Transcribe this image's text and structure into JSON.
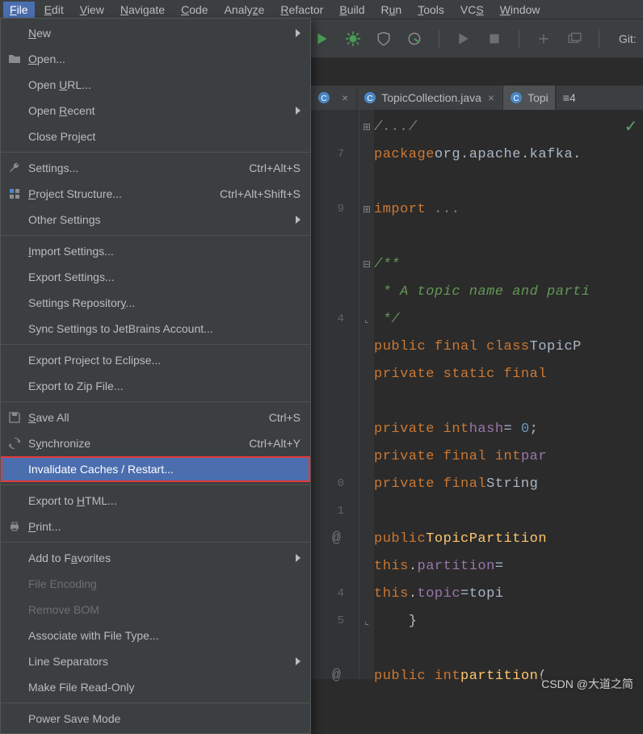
{
  "menubar": {
    "items": [
      {
        "html": "<u>F</u>ile",
        "active": true
      },
      {
        "html": "<u>E</u>dit"
      },
      {
        "html": "<u>V</u>iew"
      },
      {
        "html": "<u>N</u>avigate"
      },
      {
        "html": "<u>C</u>ode"
      },
      {
        "html": "Analy<u>z</u>e"
      },
      {
        "html": "<u>R</u>efactor"
      },
      {
        "html": "<u>B</u>uild"
      },
      {
        "html": "R<u>u</u>n"
      },
      {
        "html": "<u>T</u>ools"
      },
      {
        "html": "VC<u>S</u>"
      },
      {
        "html": "<u>W</u>indow"
      }
    ]
  },
  "file_menu": {
    "groups": [
      [
        {
          "icon": null,
          "label": "<u>N</u>ew",
          "arrow": true
        },
        {
          "icon": "folder",
          "label": "<u>O</u>pen..."
        },
        {
          "icon": null,
          "label": "Open <u>U</u>RL..."
        },
        {
          "icon": null,
          "label": "Open <u>R</u>ecent",
          "arrow": true
        },
        {
          "icon": null,
          "label": "Close Pro<u>j</u>ect"
        }
      ],
      [
        {
          "icon": "wrench",
          "label": "Settings...",
          "shortcut": "Ctrl+Alt+S"
        },
        {
          "icon": "project",
          "label": "<u>P</u>roject Structure...",
          "shortcut": "Ctrl+Alt+Shift+S"
        },
        {
          "icon": null,
          "label": "Other Settings",
          "arrow": true
        }
      ],
      [
        {
          "icon": null,
          "label": "<u>I</u>mport Settings..."
        },
        {
          "icon": null,
          "label": "Export Settings..."
        },
        {
          "icon": null,
          "label": "Settings Repositor<u>y</u>..."
        },
        {
          "icon": null,
          "label": "Sync Settings to JetBrains Account..."
        }
      ],
      [
        {
          "icon": null,
          "label": "Export Project to Eclipse..."
        },
        {
          "icon": null,
          "label": "Export to Zip File..."
        }
      ],
      [
        {
          "icon": "save",
          "label": "<u>S</u>ave All",
          "shortcut": "Ctrl+S"
        },
        {
          "icon": "sync",
          "label": "S<u>y</u>nchronize",
          "shortcut": "Ctrl+Alt+Y"
        },
        {
          "icon": null,
          "label": "Invalidate Caches / Restart...",
          "highlighted": true
        }
      ],
      [
        {
          "icon": null,
          "label": "Export to <u>H</u>TML..."
        },
        {
          "icon": "print",
          "label": "<u>P</u>rint..."
        }
      ],
      [
        {
          "icon": null,
          "label": "Add to F<u>a</u>vorites",
          "arrow": true
        },
        {
          "icon": null,
          "label": "File Encoding",
          "disabled": true
        },
        {
          "icon": null,
          "label": "Remove BOM",
          "disabled": true
        },
        {
          "icon": null,
          "label": "Associate with File Type..."
        },
        {
          "icon": null,
          "label": "Line Separators",
          "arrow": true
        },
        {
          "icon": null,
          "label": "Make File Read-Only"
        }
      ],
      [
        {
          "icon": null,
          "label": "Power Save Mode"
        }
      ]
    ]
  },
  "toolbar": {
    "git_label": "Git:"
  },
  "tabs": {
    "items": [
      {
        "label": "",
        "trunc": true,
        "close": true
      },
      {
        "label": "TopicCollection.java",
        "close": true
      },
      {
        "label": "Topi",
        "active": true
      }
    ],
    "overflow": "≡4"
  },
  "editor": {
    "lines": [
      {
        "ln": "",
        "html": "<span class='cmt'>/.../</span>",
        "fold": "box"
      },
      {
        "ln": "7",
        "html": "<span class='kw'>package</span> <span class='pkg'>org.apache.kafka</span>."
      },
      {
        "ln": "",
        "html": ""
      },
      {
        "ln": "9",
        "html": "<span class='kw'>import</span><span class='cmt'> ...</span>",
        "fold": "plus"
      },
      {
        "ln": "",
        "html": ""
      },
      {
        "ln": "",
        "html": "<span class='doc'>/**</span>",
        "fold": "minusTop"
      },
      {
        "ln": "",
        "html": "<span class='doc'> * A topic name and parti</span>"
      },
      {
        "ln": "4",
        "html": "<span class='doc'> */</span>",
        "fold": "minusBot"
      },
      {
        "ln": "",
        "html": "<span class='kw'>public final class</span> <span class='cls'>TopicP</span>"
      },
      {
        "ln": "",
        "html": "    <span class='kw'>private static final </span>"
      },
      {
        "ln": "",
        "html": ""
      },
      {
        "ln": "",
        "html": "    <span class='kw'>private int</span> <span class='fld'>hash</span> <span class='op'>= </span><span class='num'>0</span>;"
      },
      {
        "ln": "",
        "html": "    <span class='kw'>private final int</span> <span class='fld'>par</span>"
      },
      {
        "ln": "0",
        "html": "    <span class='kw'>private final</span> <span class='cls'>String</span> "
      },
      {
        "ln": "1",
        "html": ""
      },
      {
        "ln": "",
        "html": "    <span class='kw'>public</span> <span class='mth'>TopicPartition</span>",
        "at": true
      },
      {
        "ln": "",
        "html": "        <span class='kw'>this</span>.<span class='fld'>partition</span> <span class='op'>= </span>"
      },
      {
        "ln": "4",
        "html": "        <span class='kw'>this</span>.<span class='fld'>topic</span> <span class='op'>=</span> <span class='plain'>topi</span>"
      },
      {
        "ln": "5",
        "html": "    }",
        "fold": "minusBot"
      },
      {
        "ln": "",
        "html": ""
      },
      {
        "ln": "",
        "html": "    <span class='kw'>public int</span> <span class='mth'>partition</span>(",
        "at": true
      }
    ]
  },
  "watermark": "CSDN @大道之简"
}
